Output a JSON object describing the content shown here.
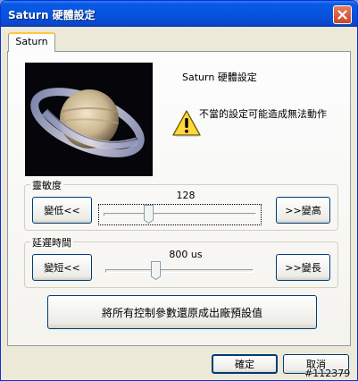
{
  "window": {
    "title": "Saturn 硬體設定"
  },
  "tabs": [
    {
      "label": "Saturn"
    }
  ],
  "info": {
    "heading": "Saturn 硬體設定",
    "warning": "不當的設定可能造成無法動作"
  },
  "sensitivity": {
    "label": "靈敏度",
    "value": "128",
    "level": 0.28,
    "decrease_label": "變低<<",
    "increase_label": ">>變高"
  },
  "delay": {
    "label": "延遲時間",
    "value": "800 us",
    "level": 0.33,
    "decrease_label": "變短<<",
    "increase_label": ">>變長"
  },
  "reset_label": "將所有控制參數還原成出廠預設值",
  "footer": {
    "ok_label": "確定",
    "cancel_label": "取消"
  },
  "watermark": "#112379",
  "colors": {
    "titlebar": "#0653df",
    "dialog_bg": "#ece9d8",
    "button_border": "#003c74"
  },
  "icons": [
    "close-icon",
    "warning-icon",
    "saturn-photo",
    "slider-thumb"
  ]
}
